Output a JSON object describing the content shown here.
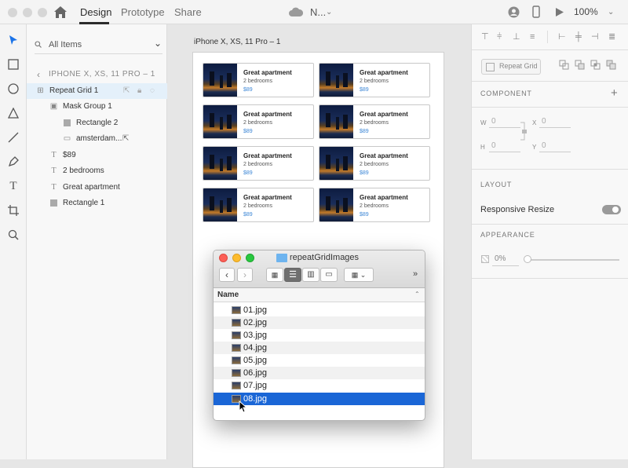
{
  "titlebar": {
    "tabs": [
      {
        "label": "Design"
      },
      {
        "label": "Prototype"
      },
      {
        "label": "Share"
      }
    ],
    "doc_name": "N...",
    "zoom": "100%"
  },
  "layers": {
    "filter_label": "All Items",
    "breadcrumb": "IPHONE X, XS, 11 PRO – 1",
    "items": [
      {
        "label": "Repeat Grid 1"
      },
      {
        "label": "Mask Group 1"
      },
      {
        "label": "Rectangle 2"
      },
      {
        "label": "amsterdam..."
      },
      {
        "label": "$89"
      },
      {
        "label": "2 bedrooms"
      },
      {
        "label": "Great apartment"
      },
      {
        "label": "Rectangle 1"
      }
    ]
  },
  "canvas": {
    "artboard_label": "iPhone X, XS, 11 Pro – 1",
    "cards": [
      {
        "title": "Great apartment",
        "subtitle": "2 bedrooms",
        "price": "$89"
      },
      {
        "title": "Great apartment",
        "subtitle": "2 bedrooms",
        "price": "$89"
      },
      {
        "title": "Great apartment",
        "subtitle": "2 bedrooms",
        "price": "$89"
      },
      {
        "title": "Great apartment",
        "subtitle": "2 bedrooms",
        "price": "$89"
      },
      {
        "title": "Great apartment",
        "subtitle": "2 bedrooms",
        "price": "$89"
      },
      {
        "title": "Great apartment",
        "subtitle": "2 bedrooms",
        "price": "$89"
      },
      {
        "title": "Great apartment",
        "subtitle": "2 bedrooms",
        "price": "$89"
      },
      {
        "title": "Great apartment",
        "subtitle": "2 bedrooms",
        "price": "$89"
      }
    ]
  },
  "props": {
    "repeat_grid_label": "Repeat Grid",
    "component_title": "COMPONENT",
    "w_label": "W",
    "w_value": "0",
    "x_label": "X",
    "x_value": "0",
    "h_label": "H",
    "h_value": "0",
    "y_label": "Y",
    "y_value": "0",
    "layout_title": "LAYOUT",
    "responsive_resize_label": "Responsive Resize",
    "appearance_title": "APPEARANCE",
    "opacity_value": "0%"
  },
  "finder": {
    "title": "repeatGridImages",
    "column_name": "Name",
    "more": "»",
    "files": [
      {
        "name": "01.jpg"
      },
      {
        "name": "02.jpg"
      },
      {
        "name": "03.jpg"
      },
      {
        "name": "04.jpg"
      },
      {
        "name": "05.jpg"
      },
      {
        "name": "06.jpg"
      },
      {
        "name": "07.jpg"
      },
      {
        "name": "08.jpg"
      }
    ],
    "selected_file": "08.jpg"
  },
  "colors": {
    "accent_blue": "#3d87d6",
    "finder_selection": "#1a66d6",
    "layer_selection": "#e4f0fa"
  }
}
